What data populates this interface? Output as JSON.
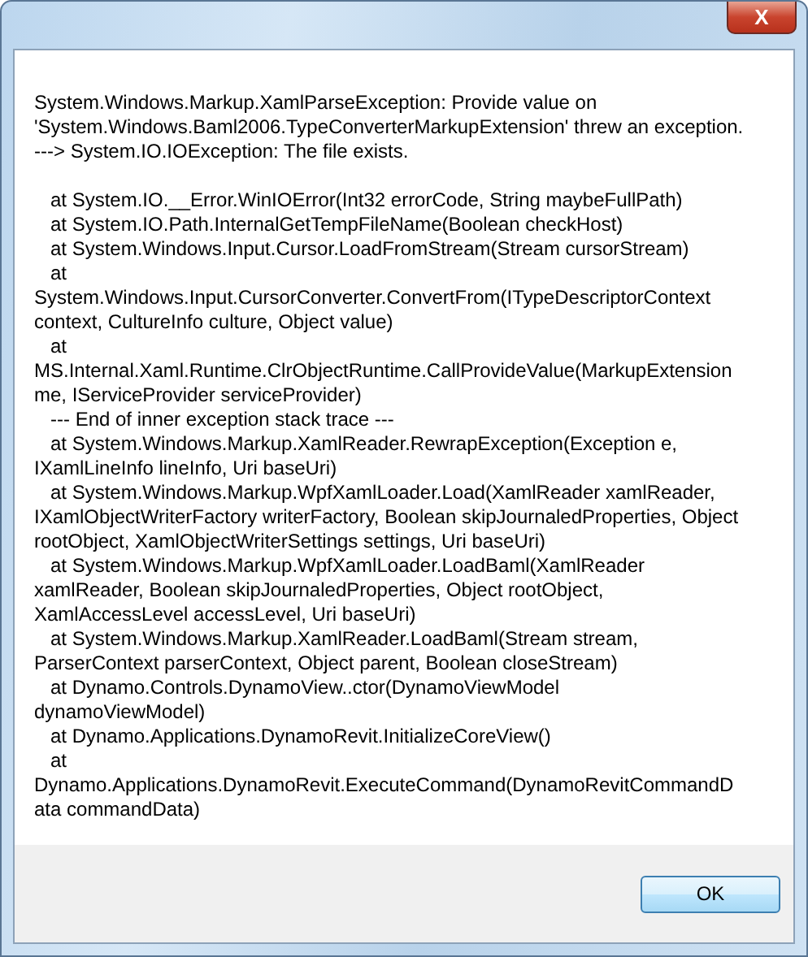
{
  "window": {
    "close_glyph": "X"
  },
  "message": "System.Windows.Markup.XamlParseException: Provide value on\n'System.Windows.Baml2006.TypeConverterMarkupExtension' threw an exception.\n---> System.IO.IOException: The file exists.\n\n   at System.IO.__Error.WinIOError(Int32 errorCode, String maybeFullPath)\n   at System.IO.Path.InternalGetTempFileName(Boolean checkHost)\n   at System.Windows.Input.Cursor.LoadFromStream(Stream cursorStream)\n   at\nSystem.Windows.Input.CursorConverter.ConvertFrom(ITypeDescriptorContext\ncontext, CultureInfo culture, Object value)\n   at\nMS.Internal.Xaml.Runtime.ClrObjectRuntime.CallProvideValue(MarkupExtension\nme, IServiceProvider serviceProvider)\n   --- End of inner exception stack trace ---\n   at System.Windows.Markup.XamlReader.RewrapException(Exception e,\nIXamlLineInfo lineInfo, Uri baseUri)\n   at System.Windows.Markup.WpfXamlLoader.Load(XamlReader xamlReader,\nIXamlObjectWriterFactory writerFactory, Boolean skipJournaledProperties, Object\nrootObject, XamlObjectWriterSettings settings, Uri baseUri)\n   at System.Windows.Markup.WpfXamlLoader.LoadBaml(XamlReader\nxamlReader, Boolean skipJournaledProperties, Object rootObject,\nXamlAccessLevel accessLevel, Uri baseUri)\n   at System.Windows.Markup.XamlReader.LoadBaml(Stream stream,\nParserContext parserContext, Object parent, Boolean closeStream)\n   at Dynamo.Controls.DynamoView..ctor(DynamoViewModel\ndynamoViewModel)\n   at Dynamo.Applications.DynamoRevit.InitializeCoreView()\n   at\nDynamo.Applications.DynamoRevit.ExecuteCommand(DynamoRevitCommandD\nata commandData)",
  "buttons": [
    {
      "label": "OK"
    }
  ]
}
